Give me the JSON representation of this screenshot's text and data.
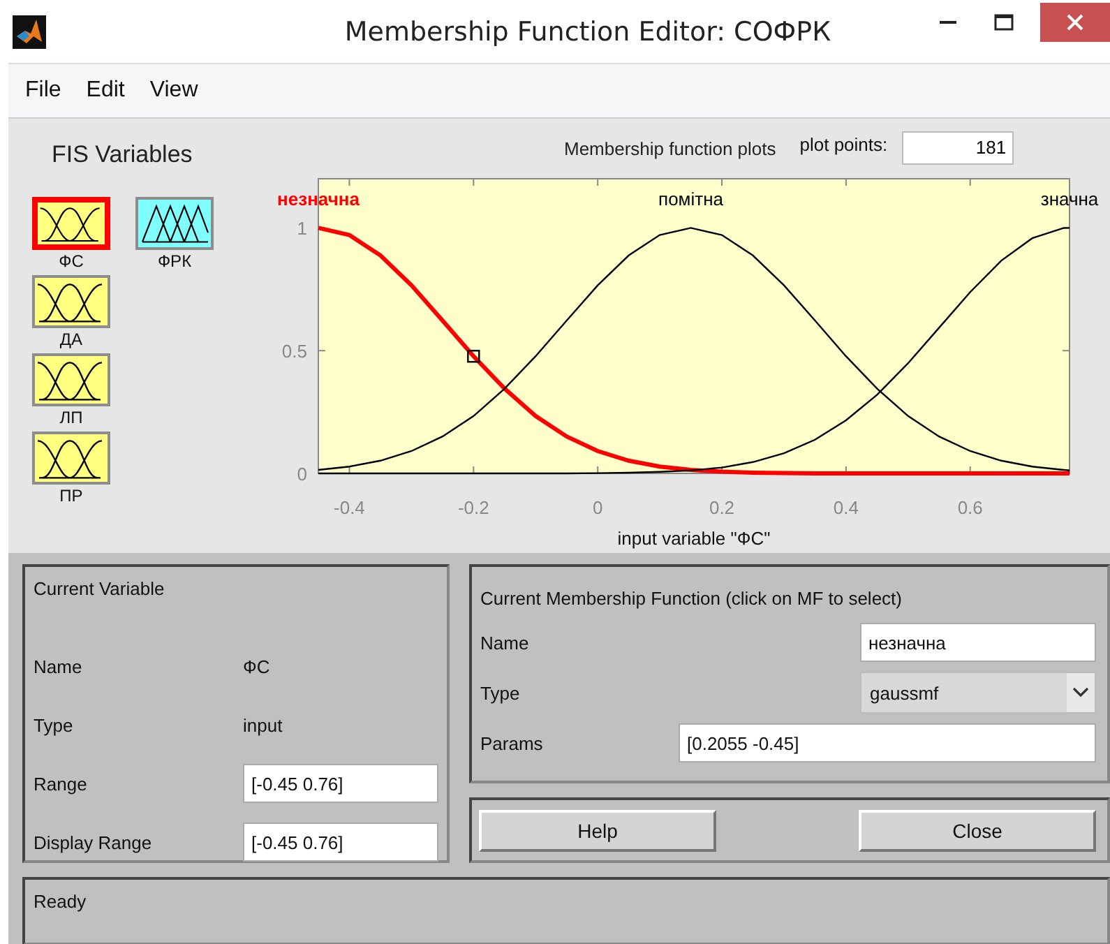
{
  "window": {
    "title": "Membership Function Editor: СОФРК"
  },
  "menu": [
    "File",
    "Edit",
    "View"
  ],
  "fis_variables": {
    "title": "FIS Variables",
    "items": [
      {
        "name": "ФС",
        "kind": "input",
        "selected": true
      },
      {
        "name": "ФРК",
        "kind": "output",
        "selected": false
      },
      {
        "name": "ДА",
        "kind": "input",
        "selected": false
      },
      {
        "name": "ЛП",
        "kind": "input",
        "selected": false
      },
      {
        "name": "ПР",
        "kind": "input",
        "selected": false
      }
    ]
  },
  "plot": {
    "title": "Membership function plots",
    "plot_points_label": "plot points:",
    "plot_points": "181",
    "chart_data": {
      "type": "line",
      "xlabel": "input variable \"ФС\"",
      "xlim": [
        -0.45,
        0.76
      ],
      "ylim": [
        0,
        1.2
      ],
      "xticks": [
        -0.4,
        -0.2,
        0,
        0.2,
        0.4,
        0.6
      ],
      "yticks": [
        0,
        0.5,
        1
      ],
      "x": [
        -0.45,
        -0.4,
        -0.35,
        -0.3,
        -0.25,
        -0.2,
        -0.15,
        -0.1,
        -0.05,
        0,
        0.05,
        0.1,
        0.15,
        0.2,
        0.25,
        0.3,
        0.35,
        0.4,
        0.45,
        0.5,
        0.55,
        0.6,
        0.65,
        0.7,
        0.75,
        0.76
      ],
      "series": [
        {
          "name": "незначна",
          "color": "#ff0000",
          "values": [
            1,
            0.971,
            0.888,
            0.766,
            0.623,
            0.477,
            0.345,
            0.234,
            0.15,
            0.091,
            0.052,
            0.028,
            0.014,
            0.007,
            0.003,
            0.001,
            0,
            0,
            0,
            0,
            0,
            0,
            0,
            0,
            0,
            0
          ]
        },
        {
          "name": "помітна",
          "color": "#000000",
          "values": [
            0.014,
            0.028,
            0.052,
            0.091,
            0.15,
            0.234,
            0.345,
            0.477,
            0.623,
            0.766,
            0.888,
            0.971,
            1,
            0.971,
            0.888,
            0.766,
            0.623,
            0.477,
            0.345,
            0.234,
            0.15,
            0.091,
            0.052,
            0.028,
            0.014,
            0.012
          ]
        },
        {
          "name": "значна",
          "color": "#000000",
          "values": [
            0,
            0,
            0,
            0,
            0,
            0,
            0,
            0,
            0,
            0.001,
            0.003,
            0.006,
            0.012,
            0.024,
            0.046,
            0.082,
            0.137,
            0.216,
            0.32,
            0.449,
            0.593,
            0.739,
            0.866,
            0.958,
            0.999,
            1
          ]
        }
      ]
    }
  },
  "current_variable": {
    "title": "Current Variable",
    "name_label": "Name",
    "name": "ФС",
    "type_label": "Type",
    "type": "input",
    "range_label": "Range",
    "range": "[-0.45 0.76]",
    "display_range_label": "Display Range",
    "display_range": "[-0.45 0.76]"
  },
  "current_mf": {
    "title": "Current Membership Function (click on MF to select)",
    "name_label": "Name",
    "name": "незначна",
    "type_label": "Type",
    "type": "gaussmf",
    "params_label": "Params",
    "params": "[0.2055 -0.45]"
  },
  "buttons": [
    "Help",
    "Close"
  ],
  "status": "Ready"
}
